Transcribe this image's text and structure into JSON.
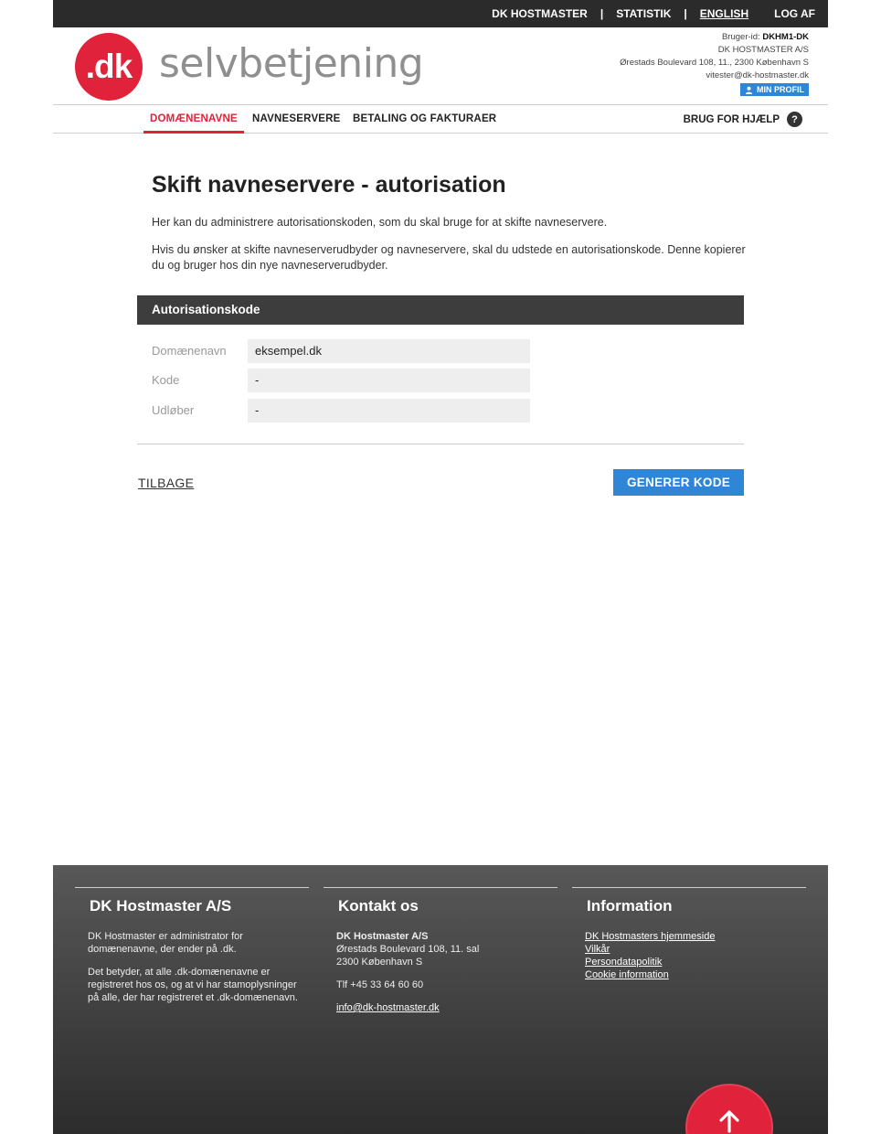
{
  "topnav": {
    "hostmaster": "DK HOSTMASTER",
    "sep": "|",
    "statistik": "STATISTIK",
    "english": "ENGLISH",
    "logout": "LOG AF"
  },
  "header": {
    "logo_mark": ".dk",
    "logo_text": "selvbetjening",
    "user_id_label": "Bruger-id:",
    "user_id": "DKHM1-DK",
    "company": "DK HOSTMASTER A/S",
    "address": "Ørestads Boulevard 108, 11., 2300 København S",
    "email": "vitester@dk-hostmaster.dk",
    "profile_button": "MIN PROFIL"
  },
  "mainnav": {
    "items": [
      {
        "label": "DOMÆNENAVNE",
        "active": true
      },
      {
        "label": "NAVNESERVERE",
        "active": false
      },
      {
        "label": "BETALING OG FAKTURAER",
        "active": false
      }
    ],
    "help": "BRUG FOR HJÆLP",
    "help_icon": "?"
  },
  "content": {
    "title": "Skift navneservere - autorisation",
    "intro1": "Her kan du administrere autorisationskoden, som du skal bruge for at skifte navneservere.",
    "intro2": "Hvis du ønsker at skifte navneserverudbyder og navneservere, skal du udstede en autorisationskode. Denne kopierer du og bruger hos din nye navneserverudbyder.",
    "panel_title": "Autorisationskode",
    "fields": [
      {
        "label": "Domænenavn",
        "value": "eksempel.dk"
      },
      {
        "label": "Kode",
        "value": "-"
      },
      {
        "label": "Udløber",
        "value": "-"
      }
    ],
    "back": "TILBAGE",
    "generate": "GENERER KODE"
  },
  "footer": {
    "col1": {
      "title": "DK Hostmaster A/S",
      "p1": "DK Hostmaster er administrator for domænenavne, der ender på .dk.",
      "p2": "Det betyder, at alle .dk-domænenavne er registreret hos os, og at vi har stamoplysninger på alle, der har registreret et .dk-domænenavn."
    },
    "col2": {
      "title": "Kontakt os",
      "name": "DK Hostmaster A/S",
      "street": "Ørestads Boulevard 108, 11. sal",
      "city": "2300 København S",
      "phone": "Tlf +45 33 64 60 60",
      "email": "info@dk-hostmaster.dk"
    },
    "col3": {
      "title": "Information",
      "links": [
        "DK Hostmasters hjemmeside",
        "Vilkår",
        "Persondatapolitik",
        "Cookie information"
      ]
    }
  },
  "colors": {
    "brand_red": "#e0223a",
    "accent_blue": "#2f86d6",
    "topbar": "#2b2b2b",
    "panel_header": "#3d3d3d"
  },
  "icons": {
    "profile": "user-icon",
    "help": "question-icon",
    "scroll_top": "arrow-up-icon"
  }
}
